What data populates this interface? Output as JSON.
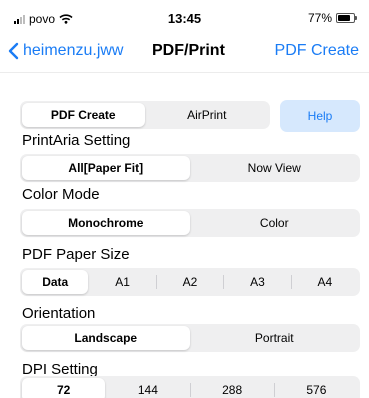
{
  "status": {
    "carrier": "povo",
    "time": "13:45",
    "battery": "77%",
    "battery_level": 0.77
  },
  "nav": {
    "back_label": "heimenzu.jww",
    "title": "PDF/Print",
    "action_label": "PDF Create"
  },
  "mode": {
    "options": [
      "PDF Create",
      "AirPrint"
    ],
    "selected": "PDF Create",
    "help_label": "Help"
  },
  "print_area": {
    "label": "PrintAria Setting",
    "options": [
      "All[Paper Fit]",
      "Now View"
    ],
    "selected": "All[Paper Fit]"
  },
  "color_mode": {
    "label": "Color Mode",
    "options": [
      "Monochrome",
      "Color"
    ],
    "selected": "Monochrome"
  },
  "paper_size": {
    "label": "PDF Paper Size",
    "options": [
      "Data",
      "A1",
      "A2",
      "A3",
      "A4"
    ],
    "selected": "Data"
  },
  "orientation": {
    "label": "Orientation",
    "options": [
      "Landscape",
      "Portrait"
    ],
    "selected": "Landscape"
  },
  "dpi": {
    "label": "DPI Setting",
    "options": [
      "72",
      "144",
      "288",
      "576"
    ],
    "selected": "72"
  },
  "colors": {
    "accent": "#1a7cf5",
    "help_bg": "#d6e8fd",
    "segment_bg": "#efeff0"
  }
}
